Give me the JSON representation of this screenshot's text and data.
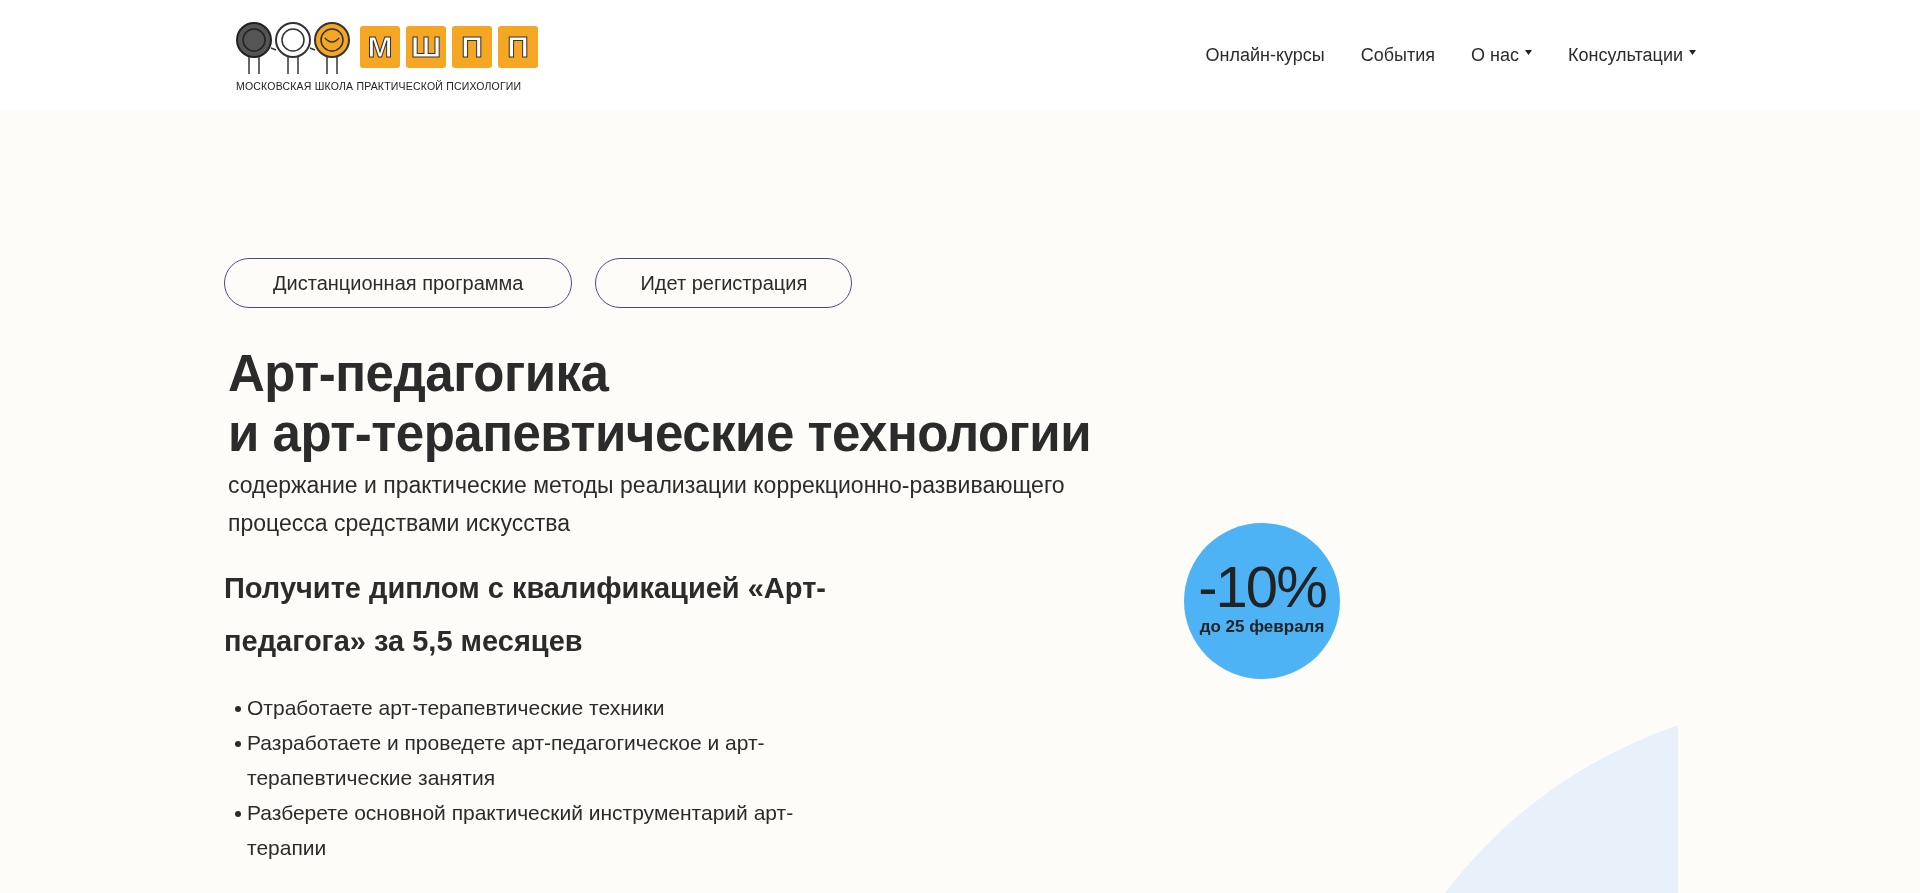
{
  "header": {
    "logo": {
      "letters": [
        "М",
        "Ш",
        "П",
        "П"
      ],
      "caption": "МОСКОВСКАЯ ШКОЛА ПРАКТИЧЕСКОЙ ПСИХОЛОГИИ"
    },
    "nav": [
      {
        "label": "Онлайн-курсы",
        "dropdown": false
      },
      {
        "label": "События",
        "dropdown": false
      },
      {
        "label": "О нас",
        "dropdown": true
      },
      {
        "label": "Консультации",
        "dropdown": true
      }
    ]
  },
  "hero": {
    "tags": [
      "Дистанционная программа",
      "Идет регистрация"
    ],
    "title": [
      "Арт-педагогика",
      "и арт-терапевтические технологии"
    ],
    "subtitle": "содержание и практические методы реализации коррекционно-развивающего процесса средствами искусства",
    "headline": "Получите диплом с квалификацией «Арт-педагога» за 5,5 месяцев",
    "bullets": [
      "Отработаете арт-терапевтические техники",
      "Разработаете и проведете арт-педагогическое и арт-терапевтические занятия",
      "Разберете основной практический инструментарий арт-терапии"
    ],
    "discount": {
      "value": "-10%",
      "until": "до 25 февраля"
    }
  }
}
